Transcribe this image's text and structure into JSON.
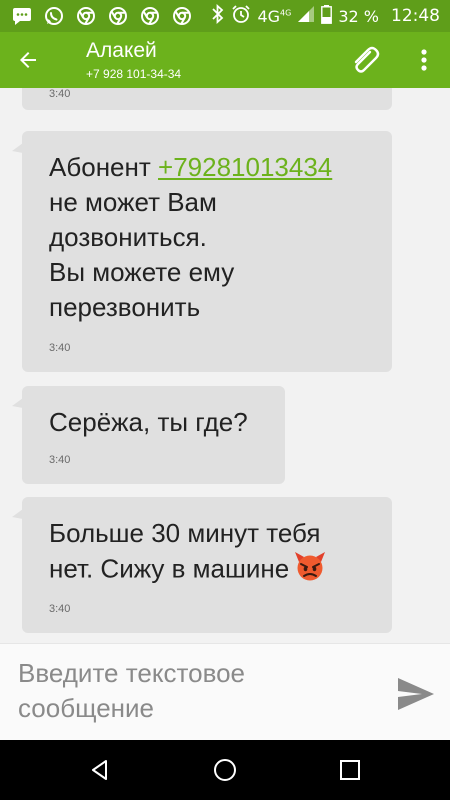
{
  "status_bar": {
    "network": "4G",
    "network_sub": "4G",
    "battery": "32 %",
    "time": "12:48",
    "icons": [
      "message-icon",
      "whatsapp-icon",
      "chrome-icon",
      "chrome-icon",
      "chrome-icon",
      "chrome-icon",
      "bluetooth-icon",
      "alarm-icon",
      "signal-icon",
      "battery-icon"
    ]
  },
  "header": {
    "contact_name": "Алакей",
    "contact_phone": "+7 928 101-34-34"
  },
  "messages": [
    {
      "text": "",
      "time": "3:40"
    },
    {
      "text_before": "Абонент ",
      "link": "+79281013434",
      "text_after": "\nне может Вам\nдозвониться.\nВы можете ему\nперезвонить",
      "time": "3:40"
    },
    {
      "text": "Серёжа, ты где?",
      "time": "3:40"
    },
    {
      "text": "Больше 30 минут тебя\nнет. Сижу в машине",
      "emoji": "angry-devil",
      "time": "3:40"
    }
  ],
  "composer": {
    "placeholder": "Введите текстовое сообщение"
  },
  "colors": {
    "status_bar": "#5f9e1a",
    "app_bar": "#6cb21c",
    "bubble": "#e0e0e0",
    "link": "#6cb21c"
  }
}
